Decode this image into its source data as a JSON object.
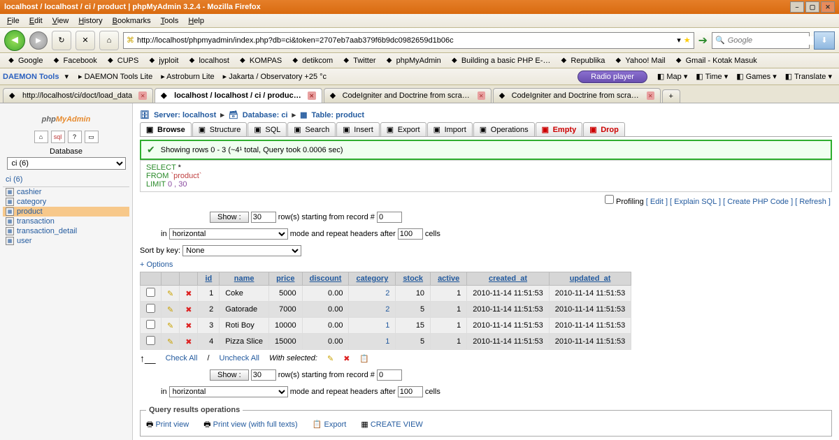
{
  "window": {
    "title": "localhost / localhost / ci / product  |  phpMyAdmin 3.2.4 - Mozilla Firefox"
  },
  "menu": [
    "File",
    "Edit",
    "View",
    "History",
    "Bookmarks",
    "Tools",
    "Help"
  ],
  "nav": {
    "url": "http://localhost/phpmyadmin/index.php?db=ci&token=2707eb7aab379f6b9dc0982659d1b06c",
    "search_placeholder": "Google"
  },
  "bookmarks": [
    "Google",
    "Facebook",
    "CUPS",
    "jyploit",
    "localhost",
    "KOMPAS",
    "detikcom",
    "Twitter",
    "phpMyAdmin",
    "Building a basic PHP E-…",
    "Republika",
    "Yahoo! Mail",
    "Gmail - Kotak Masuk"
  ],
  "toolbar2": {
    "daemon": "DAEMON Tools",
    "items": [
      "DAEMON Tools Lite",
      "Astroburn Lite",
      "Jakarta / Observatory +25 °c"
    ],
    "radio": "Radio player",
    "right": [
      "Map",
      "Time",
      "Games",
      "Translate"
    ]
  },
  "tabs": [
    {
      "label": "http://localhost/ci/doct/load_data",
      "active": false
    },
    {
      "label": "localhost / localhost / ci / produc…",
      "active": true
    },
    {
      "label": "CodeIgniter and Doctrine from scratch …",
      "active": false
    },
    {
      "label": "CodeIgniter and Doctrine from scratch …",
      "active": false
    }
  ],
  "sidebar": {
    "db_label": "Database",
    "db_selected": "ci (6)",
    "db_name": "ci (6)",
    "tables": [
      "cashier",
      "category",
      "product",
      "transaction",
      "transaction_detail",
      "user"
    ],
    "selected_table": "product"
  },
  "breadcrumb": {
    "server": "Server: localhost",
    "database": "Database: ci",
    "table": "Table: product"
  },
  "pma_tabs": [
    "Browse",
    "Structure",
    "SQL",
    "Search",
    "Insert",
    "Export",
    "Import",
    "Operations",
    "Empty",
    "Drop"
  ],
  "success": "Showing rows 0 - 3 (~4¹ total, Query took 0.0006 sec)",
  "sql": {
    "l1a": "SELECT",
    "l1b": " *",
    "l2a": "FROM ",
    "l2b": "`product`",
    "l3a": "LIMIT ",
    "l3b": "0 , 30"
  },
  "links": {
    "profiling": "Profiling",
    "edit": "Edit",
    "explain": "Explain SQL",
    "create": "Create PHP Code",
    "refresh": "Refresh"
  },
  "controls": {
    "show": "Show :",
    "rows": "30",
    "start_label": "row(s) starting from record #",
    "start": "0",
    "in": "in",
    "mode": "horizontal",
    "repeat_label": "mode and repeat headers after",
    "repeat": "100",
    "cells": "cells",
    "sort_label": "Sort by key:",
    "sort_val": "None",
    "options": "+ Options"
  },
  "columns": [
    "id",
    "name",
    "price",
    "discount",
    "category",
    "stock",
    "active",
    "created_at",
    "updated_at"
  ],
  "rows": [
    {
      "id": "1",
      "name": "Coke",
      "price": "5000",
      "discount": "0.00",
      "category": "2",
      "stock": "10",
      "active": "1",
      "created_at": "2010-11-14 11:51:53",
      "updated_at": "2010-11-14 11:51:53"
    },
    {
      "id": "2",
      "name": "Gatorade",
      "price": "7000",
      "discount": "0.00",
      "category": "2",
      "stock": "5",
      "active": "1",
      "created_at": "2010-11-14 11:51:53",
      "updated_at": "2010-11-14 11:51:53"
    },
    {
      "id": "3",
      "name": "Roti Boy",
      "price": "10000",
      "discount": "0.00",
      "category": "1",
      "stock": "15",
      "active": "1",
      "created_at": "2010-11-14 11:51:53",
      "updated_at": "2010-11-14 11:51:53"
    },
    {
      "id": "4",
      "name": "Pizza Slice",
      "price": "15000",
      "discount": "0.00",
      "category": "1",
      "stock": "5",
      "active": "1",
      "created_at": "2010-11-14 11:51:53",
      "updated_at": "2010-11-14 11:51:53"
    }
  ],
  "rowactions": {
    "check": "Check All",
    "uncheck": "Uncheck All",
    "with": "With selected:"
  },
  "ops": {
    "legend": "Query results operations",
    "print": "Print view",
    "printfull": "Print view (with full texts)",
    "export": "Export",
    "createview": "CREATE VIEW"
  }
}
